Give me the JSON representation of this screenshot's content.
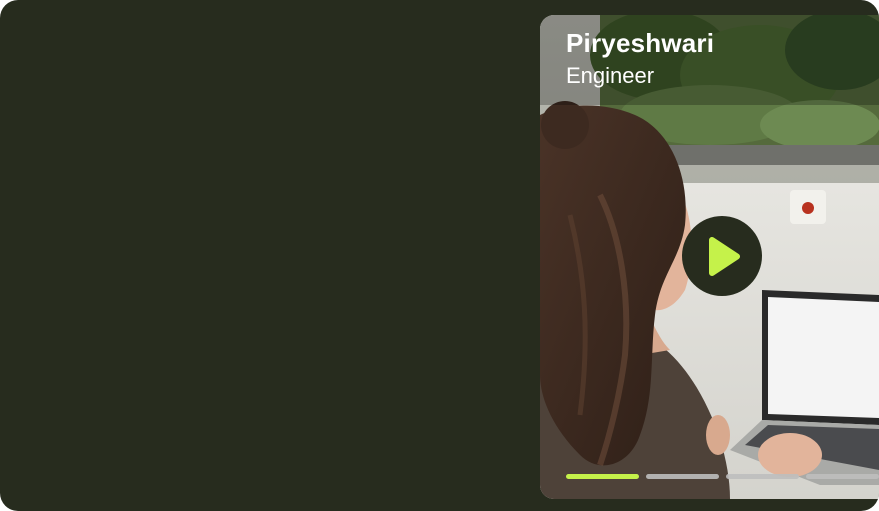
{
  "story": {
    "name": "Piryeshwari",
    "role": "Engineer",
    "play_icon": "play-icon",
    "accent_color": "#c5f24a",
    "background_color": "#272c1e",
    "progress": {
      "segments": 4,
      "active": 1,
      "played_fraction": 1.0
    }
  }
}
